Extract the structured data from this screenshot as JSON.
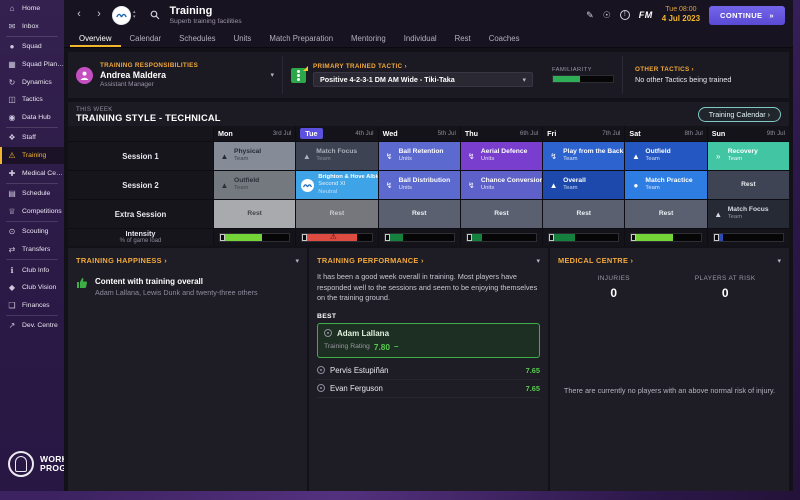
{
  "glyphs": {
    "back": "‹",
    "forward": "›",
    "up": "▴",
    "chevron_down": "▾",
    "warning": "⚠",
    "edit": "✎",
    "idea": "☉",
    "alert": "!"
  },
  "colors": {
    "accent_yellow": "#f2b52e",
    "today_purple": "#5b51de",
    "continue_purple": "#5a4ad4",
    "rating_green": "#58c94f",
    "warning_red": "#de4b41",
    "happy_green": "#3fae49"
  },
  "topbar": {
    "title": "Training",
    "subtitle": "Superb training facilities",
    "time": "Tue 08:00",
    "date": "4 Jul 2023",
    "fm": "FM",
    "continue_label": "CONTINUE",
    "continue_arrow": "»"
  },
  "tabs": {
    "active_index": 0,
    "items": [
      "Overview",
      "Calendar",
      "Schedules",
      "Units",
      "Match Preparation",
      "Mentoring",
      "Individual",
      "Rest",
      "Coaches"
    ]
  },
  "sidebar": {
    "active": "Training",
    "footer": "WORK IN PROGRESS",
    "dividers": [
      1,
      6,
      9,
      11,
      13,
      16
    ],
    "items": [
      {
        "label": "Home",
        "icon": "home-icon",
        "glyph": "⌂"
      },
      {
        "label": "Inbox",
        "icon": "inbox-icon",
        "glyph": "✉"
      },
      {
        "label": "Squad",
        "icon": "squad-icon",
        "glyph": "●"
      },
      {
        "label": "Squad Planner",
        "icon": "squad-planner-icon",
        "glyph": "▦"
      },
      {
        "label": "Dynamics",
        "icon": "dynamics-icon",
        "glyph": "↻"
      },
      {
        "label": "Tactics",
        "icon": "tactics-icon",
        "glyph": "◫"
      },
      {
        "label": "Data Hub",
        "icon": "data-hub-icon",
        "glyph": "◉"
      },
      {
        "label": "Staff",
        "icon": "staff-icon",
        "glyph": "❖"
      },
      {
        "label": "Training",
        "icon": "training-icon",
        "glyph": "⚠"
      },
      {
        "label": "Medical Centre",
        "icon": "medical-icon",
        "glyph": "✚"
      },
      {
        "label": "Schedule",
        "icon": "schedule-icon",
        "glyph": "▤"
      },
      {
        "label": "Competitions",
        "icon": "trophy-icon",
        "glyph": "♕"
      },
      {
        "label": "Scouting",
        "icon": "scouting-icon",
        "glyph": "⊙"
      },
      {
        "label": "Transfers",
        "icon": "transfers-icon",
        "glyph": "⇄"
      },
      {
        "label": "Club Info",
        "icon": "club-info-icon",
        "glyph": "ℹ"
      },
      {
        "label": "Club Vision",
        "icon": "club-vision-icon",
        "glyph": "◆"
      },
      {
        "label": "Finances",
        "icon": "finances-icon",
        "glyph": "❑"
      },
      {
        "label": "Dev. Centre",
        "icon": "dev-centre-icon",
        "glyph": "↗"
      }
    ]
  },
  "responsibilities": {
    "label": "TRAINING RESPONSIBILITIES",
    "name": "Andrea Maldera",
    "role": "Assistant Manager"
  },
  "tactic": {
    "label": "PRIMARY TRAINED TACTIC ›",
    "value": "Positive 4-2-3-1 DM AM Wide - Tiki-Taka",
    "familiarity_label": "FAMILIARITY",
    "familiarity_pct": 45
  },
  "other_tactics": {
    "label": "OTHER TACTICS ›",
    "value": "No other Tactics being trained"
  },
  "icons": {
    "cone-icon": "▲",
    "bolt-icon": "↯",
    "recovery-icon": "»",
    "ball-icon": "●"
  },
  "week": {
    "kicker": "THIS WEEK",
    "title": "TRAINING STYLE - TECHNICAL",
    "calendar_button": "Training Calendar ›",
    "days": [
      {
        "name": "Mon",
        "date": "3rd Jul"
      },
      {
        "name": "Tue",
        "date": "4th Jul",
        "today": true
      },
      {
        "name": "Wed",
        "date": "5th Jul"
      },
      {
        "name": "Thu",
        "date": "6th Jul"
      },
      {
        "name": "Fri",
        "date": "7th Jul"
      },
      {
        "name": "Sat",
        "date": "8th Jul"
      },
      {
        "name": "Sun",
        "date": "9th Jul"
      }
    ],
    "palette": {
      "gray": {
        "bg": "#868c97",
        "fg": "#262b33",
        "sub": "#3d434d"
      },
      "darkgray": {
        "bg": "#3d4352",
        "fg": "#aab0bc",
        "sub": "#868c98"
      },
      "peri": {
        "bg": "#5c69cf",
        "fg": "#ffffff",
        "sub": "#dfe2f5"
      },
      "violet": {
        "bg": "#7a3ecf",
        "fg": "#ffffff",
        "sub": "#e6d9f6"
      },
      "blue": {
        "bg": "#2d63cf",
        "fg": "#ffffff",
        "sub": "#d5e0f5"
      },
      "blue2": {
        "bg": "#2457c1",
        "fg": "#ffffff",
        "sub": "#d0dcf2"
      },
      "teal": {
        "bg": "#42c5a3",
        "fg": "#ffffff",
        "sub": "#eafaf5"
      },
      "gray2": {
        "bg": "#74787f",
        "fg": "#2b2f37",
        "sub": "#42464e"
      },
      "lightblue": {
        "bg": "#3fa3e8",
        "fg": "#ffffff",
        "sub": "#e3f2fc"
      },
      "peri2": {
        "bg": "#5f61ca",
        "fg": "#ffffff",
        "sub": "#dfe0f6"
      },
      "darkblue": {
        "bg": "#1d49ad",
        "fg": "#ffffff",
        "sub": "#cdd8ee"
      },
      "brightblue": {
        "bg": "#2d7de2",
        "fg": "#ffffff",
        "sub": "#d7e7fa"
      },
      "slatedark": {
        "bg": "#3f4454",
        "fg": "#e8eaef",
        "sub": "#b8bcc7"
      },
      "restlight": {
        "bg": "#a8aaae",
        "fg": "#41454c",
        "sub": ""
      },
      "restmid": {
        "bg": "#75777c",
        "fg": "#caccd1",
        "sub": ""
      },
      "restslate": {
        "bg": "#5a6070",
        "fg": "#eceef2",
        "sub": ""
      },
      "darkest": {
        "bg": "#262a34",
        "fg": "#d9dbe2",
        "sub": "#8f93a0"
      }
    },
    "rows": [
      {
        "label": "Session 1",
        "cells": [
          {
            "title": "Physical",
            "sub": "Team",
            "icon": "cone-icon",
            "style": "gray"
          },
          {
            "title": "Match Focus",
            "sub": "Team",
            "icon": "cone-icon",
            "style": "darkgray"
          },
          {
            "title": "Ball Retention",
            "sub": "Units",
            "icon": "bolt-icon",
            "style": "peri"
          },
          {
            "title": "Aerial Defence",
            "sub": "Units",
            "icon": "bolt-icon",
            "style": "violet"
          },
          {
            "title": "Play from the Back",
            "sub": "Team",
            "icon": "bolt-icon",
            "style": "blue"
          },
          {
            "title": "Outfield",
            "sub": "Team",
            "icon": "cone-icon",
            "style": "blue2"
          },
          {
            "title": "Recovery",
            "sub": "Team",
            "icon": "recovery-icon",
            "style": "teal"
          }
        ]
      },
      {
        "label": "Session 2",
        "cells": [
          {
            "title": "Outfield",
            "sub": "Team",
            "icon": "cone-icon",
            "style": "gray2"
          },
          {
            "title": "Brighton & Hove Albion",
            "sub": "Second XI",
            "sub2": "Neutral",
            "icon": "club-badge-icon",
            "style": "lightblue"
          },
          {
            "title": "Ball Distribution",
            "sub": "Units",
            "icon": "bolt-icon",
            "style": "peri"
          },
          {
            "title": "Chance Conversion",
            "sub": "Units",
            "icon": "bolt-icon",
            "style": "peri2"
          },
          {
            "title": "Overall",
            "sub": "Team",
            "icon": "cone-icon",
            "style": "darkblue"
          },
          {
            "title": "Match Practice",
            "sub": "Team",
            "icon": "ball-icon",
            "style": "brightblue"
          },
          {
            "title": "Rest",
            "center": true,
            "style": "slatedark"
          }
        ]
      },
      {
        "label": "Extra Session",
        "cells": [
          {
            "title": "Rest",
            "center": true,
            "style": "restlight"
          },
          {
            "title": "Rest",
            "center": true,
            "style": "restmid"
          },
          {
            "title": "Rest",
            "center": true,
            "style": "restslate"
          },
          {
            "title": "Rest",
            "center": true,
            "style": "restslate"
          },
          {
            "title": "Rest",
            "center": true,
            "style": "restslate"
          },
          {
            "title": "Rest",
            "center": true,
            "style": "restslate"
          },
          {
            "title": "Match Focus",
            "sub": "Team",
            "icon": "cone-icon",
            "style": "darkest"
          }
        ]
      }
    ],
    "intensity": {
      "label": "Intensity",
      "sublabel": "% of game load",
      "bars": [
        {
          "pct": 53,
          "color": "#74d437"
        },
        {
          "pct": 72,
          "color": "#de4b41",
          "warning": true
        },
        {
          "pct": 20,
          "color": "#15813f"
        },
        {
          "pct": 15,
          "color": "#15813f"
        },
        {
          "pct": 30,
          "color": "#15813f"
        },
        {
          "pct": 53,
          "color": "#74d437"
        },
        {
          "pct": 6,
          "color": "#2c4bb4"
        }
      ]
    }
  },
  "happiness": {
    "header": "TRAINING HAPPINESS ›",
    "title": "Content with training overall",
    "subtitle": "Adam Lallana, Lewis Dunk and twenty-three others"
  },
  "performance": {
    "header": "TRAINING PERFORMANCE ›",
    "summary": "It has been a good week overall in training. Most players have responded well to the sessions and seem to be enjoying themselves on the training ground.",
    "best_label": "BEST",
    "best": {
      "name": "Adam Lallana",
      "rating_label": "Training Rating",
      "rating": "7.80",
      "trend": "–"
    },
    "players": [
      {
        "name": "Pervis Estupiñán",
        "rating": "7.65"
      },
      {
        "name": "Evan Ferguson",
        "rating": "7.65"
      }
    ]
  },
  "medical": {
    "header": "MEDICAL CENTRE ›",
    "stats": [
      {
        "label": "INJURIES",
        "value": "0"
      },
      {
        "label": "PLAYERS AT RISK",
        "value": "0"
      }
    ],
    "note": "There are currently no players with an above normal risk of injury."
  }
}
